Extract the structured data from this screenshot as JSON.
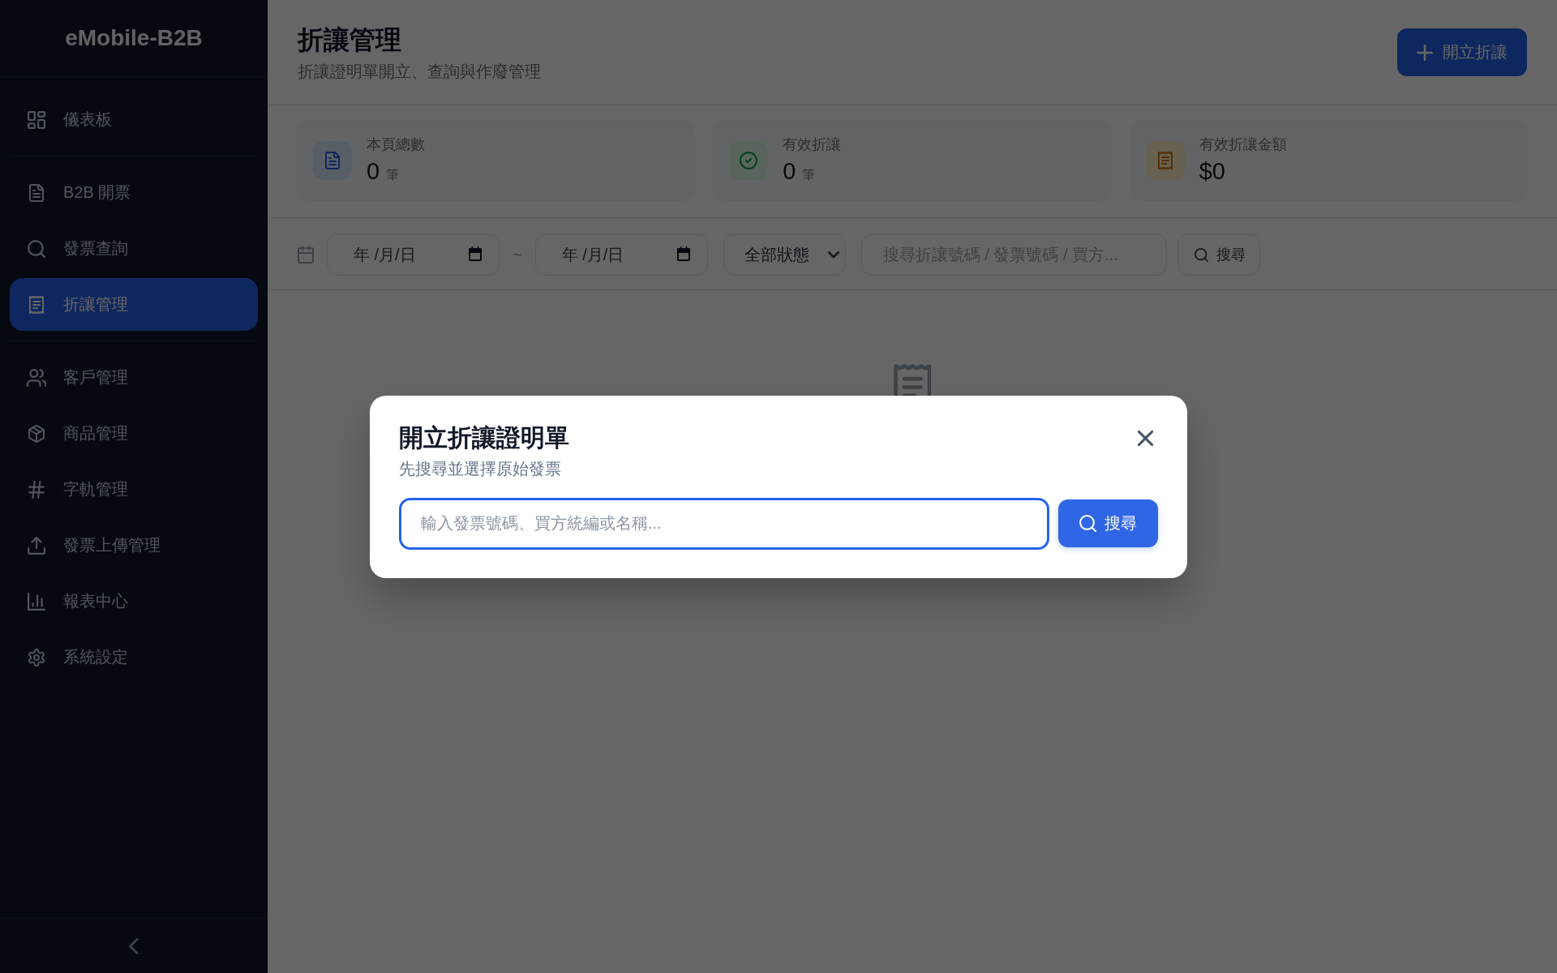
{
  "sidebar": {
    "logo": "eMobile-B2B",
    "sections": [
      {
        "items": [
          {
            "label": "儀表板",
            "selected": false
          }
        ]
      },
      {
        "items": [
          {
            "label": "B2B 開票",
            "selected": false
          },
          {
            "label": "發票查詢",
            "selected": false
          },
          {
            "label": "折讓管理",
            "selected": true
          }
        ]
      },
      {
        "items": [
          {
            "label": "客戶管理",
            "selected": false
          },
          {
            "label": "商品管理",
            "selected": false
          },
          {
            "label": "字軌管理",
            "selected": false
          },
          {
            "label": "發票上傳管理",
            "selected": false
          },
          {
            "label": "報表中心",
            "selected": false
          },
          {
            "label": "系統設定",
            "selected": false
          }
        ]
      }
    ]
  },
  "header": {
    "title": "折讓管理",
    "subtitle": "折讓證明單開立、查詢與作廢管理",
    "create_button": "開立折讓"
  },
  "stats": [
    {
      "label": "本頁總數",
      "value": "0",
      "unit": "筆"
    },
    {
      "label": "有效折讓",
      "value": "0",
      "unit": "筆"
    },
    {
      "label": "有效折讓金額",
      "value": "$0"
    }
  ],
  "filters": {
    "date_from": {
      "placeholder": "年 /月/日"
    },
    "range_separator": "~",
    "date_to": {
      "placeholder": "年 /月/日"
    },
    "status_select": {
      "value": "全部狀態"
    },
    "search": {
      "placeholder": "搜尋折讓號碼 / 發票號碼 / 買方..."
    },
    "search_button": "搜尋"
  },
  "dialog": {
    "open": true,
    "title": "開立折讓證明單",
    "subtitle": "先搜尋並選擇原始發票",
    "search": {
      "placeholder": "輸入發票號碼、買方統編或名稱...",
      "focused": true
    },
    "search_button": "搜尋"
  }
}
